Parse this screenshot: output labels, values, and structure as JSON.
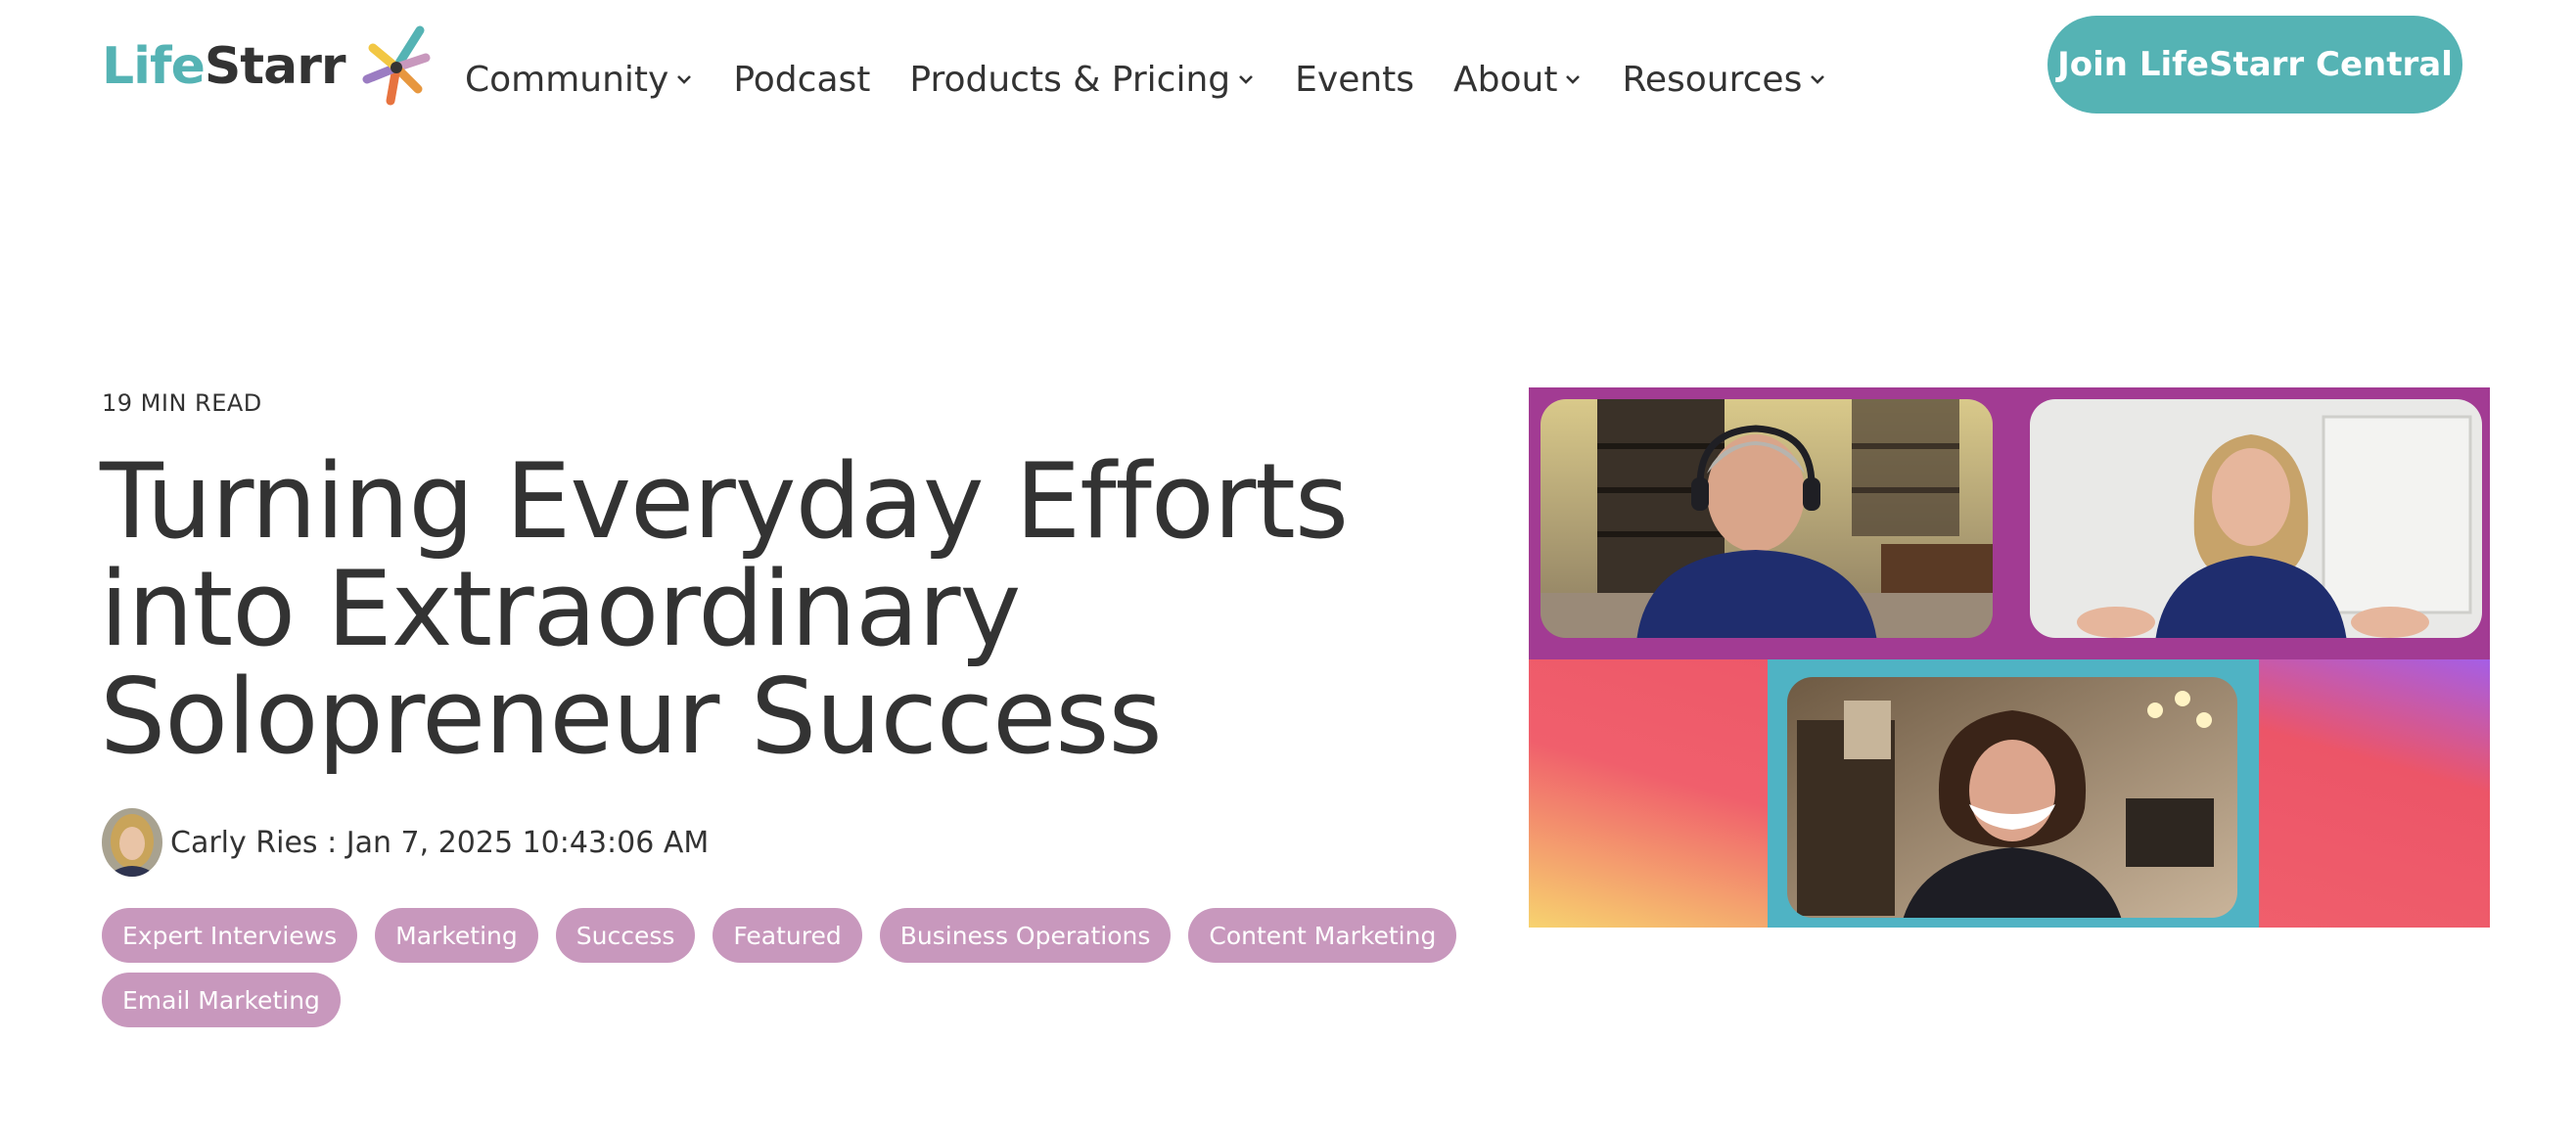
{
  "brand": {
    "logo_part1": "Life",
    "logo_part2": "Starr",
    "teal": "#55b3b4",
    "tag_color": "#c898bd",
    "text_color": "#333333"
  },
  "nav": {
    "items": [
      {
        "label": "Community",
        "has_dropdown": true
      },
      {
        "label": "Podcast",
        "has_dropdown": false
      },
      {
        "label": "Products & Pricing",
        "has_dropdown": true
      },
      {
        "label": "Events",
        "has_dropdown": false
      },
      {
        "label": "About",
        "has_dropdown": true
      },
      {
        "label": "Resources",
        "has_dropdown": true
      }
    ],
    "cta_label": "Join LifeStarr Central"
  },
  "article": {
    "read_time": "19 MIN READ",
    "title": "Turning Everyday Efforts into Extraordinary Solopreneur Success",
    "author": "Carly Ries",
    "separator": " : ",
    "date": "Jan 7, 2025 10:43:06 AM",
    "tags": [
      "Expert Interviews",
      "Marketing",
      "Success",
      "Featured",
      "Business Operations",
      "Content Marketing",
      "Email Marketing"
    ]
  },
  "hero_image": {
    "frame_top_color": "#a23b93",
    "frame_mid_color": "#4fb3c4",
    "icons": [
      "video-call-participant-man",
      "video-call-participant-woman-blonde",
      "video-call-participant-woman-curly"
    ]
  }
}
